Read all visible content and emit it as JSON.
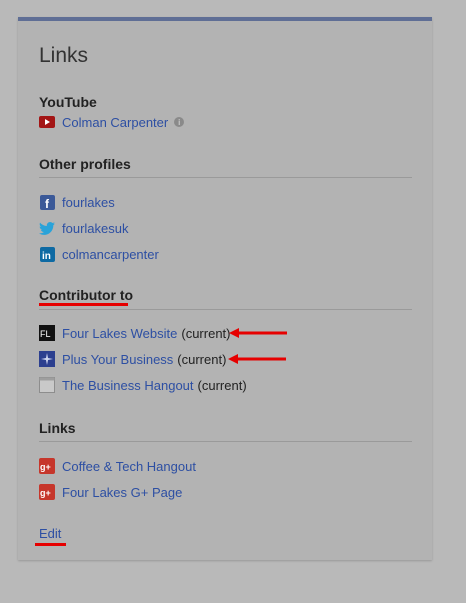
{
  "card": {
    "title": "Links"
  },
  "youtube": {
    "title": "YouTube",
    "channel_label": "Colman Carpenter",
    "info_icon": "info-icon"
  },
  "profiles": {
    "title": "Other profiles",
    "items": [
      {
        "label": "fourlakes",
        "icon": "facebook-icon"
      },
      {
        "label": "fourlakesuk",
        "icon": "twitter-icon"
      },
      {
        "label": "colmancarpenter",
        "icon": "linkedin-icon"
      }
    ]
  },
  "contributor": {
    "title": "Contributor to",
    "items": [
      {
        "label": "Four Lakes Website",
        "status": "(current)",
        "icon": "fourlakes-logo-icon"
      },
      {
        "label": "Plus Your Business",
        "status": "(current)",
        "icon": "plus-your-business-icon"
      },
      {
        "label": "The Business Hangout",
        "status": "(current)",
        "icon": "page-icon"
      }
    ]
  },
  "links": {
    "title": "Links",
    "items": [
      {
        "label": "Coffee & Tech Hangout",
        "icon": "google-plus-icon"
      },
      {
        "label": "Four Lakes G+ Page",
        "icon": "google-plus-icon"
      }
    ]
  },
  "edit_label": "Edit",
  "colors": {
    "accent": "#5f6e95",
    "link": "#2d4fa3",
    "annotation": "#e60000"
  }
}
